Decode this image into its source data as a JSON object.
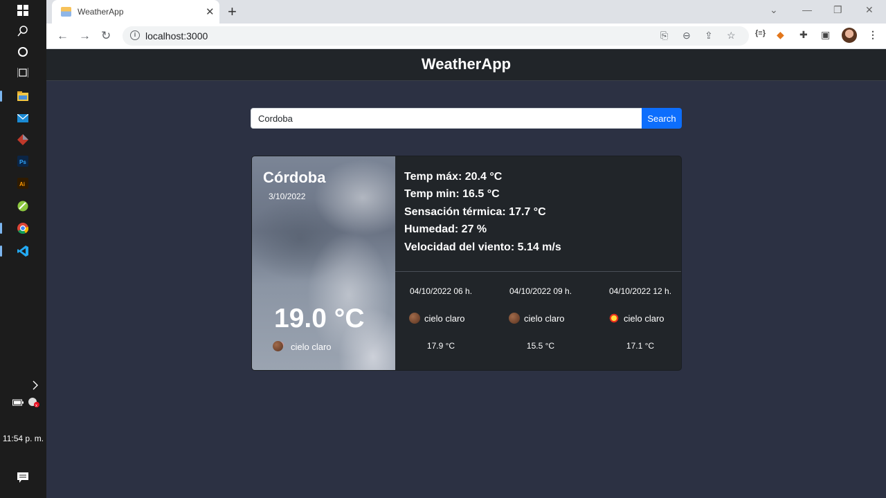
{
  "browser": {
    "tab_title": "WeatherApp",
    "url": "localhost:3000"
  },
  "taskbar": {
    "time": "11:54 p. m."
  },
  "app": {
    "title": "WeatherApp",
    "search": {
      "value": "Cordoba",
      "button_label": "Search"
    },
    "current": {
      "city": "Córdoba",
      "date": "3/10/2022",
      "temp": "19.0 °C",
      "description": "cielo claro",
      "icon": "moon-icon"
    },
    "stats": [
      "Temp máx: 20.4 °C",
      "Temp min: 16.5 °C",
      "Sensación térmica: 17.7 °C",
      "Humedad: 27 %",
      "Velocidad del viento: 5.14 m/s"
    ],
    "forecast": [
      {
        "date": "04/10/2022 06 h.",
        "description": "cielo claro",
        "temp": "17.9 °C",
        "icon": "moon-icon"
      },
      {
        "date": "04/10/2022 09 h.",
        "description": "cielo claro",
        "temp": "15.5 °C",
        "icon": "moon-icon"
      },
      {
        "date": "04/10/2022 12 h.",
        "description": "cielo claro",
        "temp": "17.1 °C",
        "icon": "sun-icon"
      }
    ]
  },
  "colors": {
    "page_bg": "#2c3143",
    "card_bg": "#212529",
    "accent": "#0d6efd"
  }
}
